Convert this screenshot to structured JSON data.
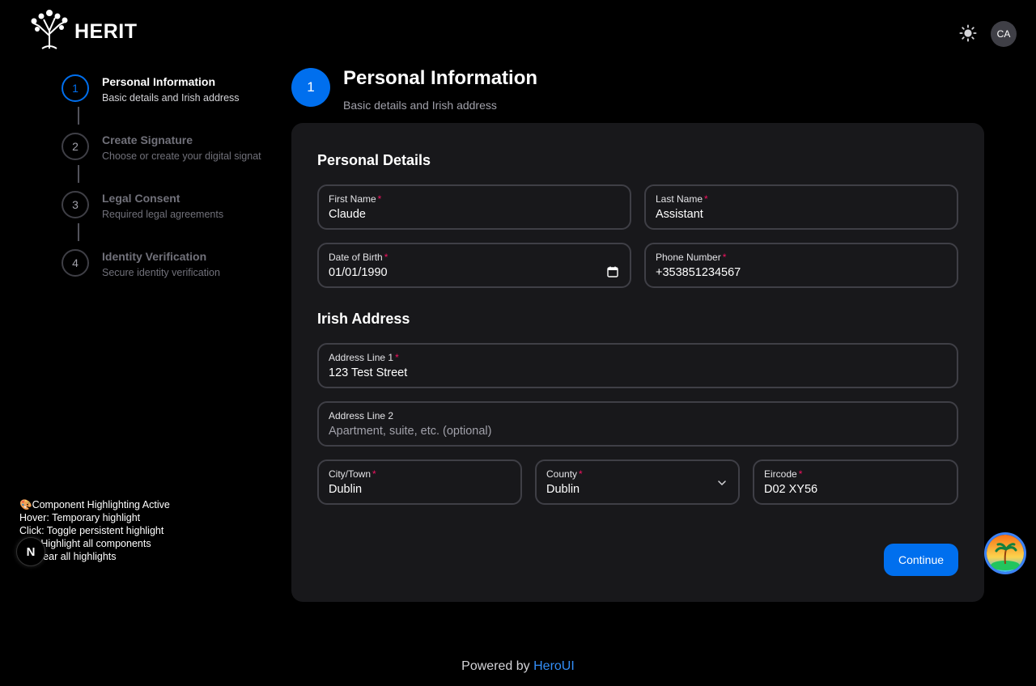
{
  "header": {
    "brand": "HERIT",
    "theme_icon": "sun-icon",
    "avatar_initials": "CA"
  },
  "stepper": {
    "steps": [
      {
        "number": "1",
        "title": "Personal Information",
        "description": "Basic details and Irish address",
        "state": "active"
      },
      {
        "number": "2",
        "title": "Create Signature",
        "description": "Choose or create your digital signat",
        "state": "upcoming"
      },
      {
        "number": "3",
        "title": "Legal Consent",
        "description": "Required legal agreements",
        "state": "upcoming"
      },
      {
        "number": "4",
        "title": "Identity Verification",
        "description": "Secure identity verification",
        "state": "upcoming"
      }
    ]
  },
  "page": {
    "step_number": "1",
    "title": "Personal Information",
    "subtitle": "Basic details and Irish address"
  },
  "form": {
    "personal_section": "Personal Details",
    "address_section": "Irish Address",
    "first_name": {
      "label": "First Name",
      "value": "Claude"
    },
    "last_name": {
      "label": "Last Name",
      "value": "Assistant"
    },
    "dob": {
      "label": "Date of Birth",
      "value": "01/01/1990"
    },
    "phone": {
      "label": "Phone Number",
      "value": "+353851234567"
    },
    "address1": {
      "label": "Address Line 1",
      "value": "123 Test Street"
    },
    "address2": {
      "label": "Address Line 2",
      "placeholder": "Apartment, suite, etc. (optional)"
    },
    "city": {
      "label": "City/Town",
      "value": "Dublin"
    },
    "county": {
      "label": "County",
      "value": "Dublin"
    },
    "eircode": {
      "label": "Eircode",
      "value": "D02 XY56"
    },
    "required_mark": "*",
    "continue_label": "Continue"
  },
  "footer": {
    "prefix": "Powered by",
    "link": "HeroUI"
  },
  "debug_overlay": {
    "lines": [
      "🎨Component Highlighting Active",
      "Hover: Temporary highlight",
      "Click: Toggle persistent highlight",
      "   H: Highlight all components",
      "     Clear all highlights"
    ],
    "badge": "N"
  },
  "colors": {
    "primary": "#006fee",
    "required": "#f31260",
    "card": "#18181b",
    "border": "#3f3f46"
  }
}
